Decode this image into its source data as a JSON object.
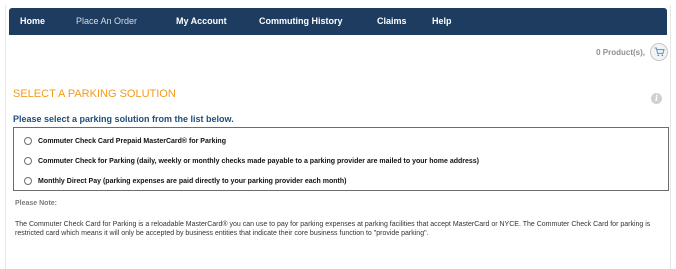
{
  "nav": {
    "items": [
      {
        "label": "Home"
      },
      {
        "label": "Place An Order"
      },
      {
        "label": "My Account"
      },
      {
        "label": "Commuting History"
      },
      {
        "label": "Claims"
      },
      {
        "label": "Help"
      }
    ]
  },
  "cart": {
    "text": "0 Product(s),",
    "icon": "shopping-cart-icon"
  },
  "page": {
    "heading": "SELECT A PARKING SOLUTION",
    "info_icon": "info-icon",
    "subheading": "Please select a parking solution from the list below."
  },
  "options": [
    {
      "label": "Commuter Check Card Prepaid MasterCard® for Parking"
    },
    {
      "label": "Commuter Check for Parking (daily, weekly or monthly checks made payable to a parking provider are mailed to your home address)"
    },
    {
      "label": "Monthly Direct Pay (parking expenses are paid directly to your parking provider each month)"
    }
  ],
  "note": {
    "label": "Please Note:",
    "text": "The Commuter Check Card for Parking is a reloadable MasterCard® you can use to pay for parking expenses at parking facilities that accept MasterCard or NYCE. The Commuter Check Card for parking is restricted card which means it will only be accepted by business entities that indicate their core business function to \"provide parking\"."
  },
  "colors": {
    "nav_bg": "#1d3c60",
    "heading": "#f39a1c",
    "subheading": "#1d4e7a"
  }
}
